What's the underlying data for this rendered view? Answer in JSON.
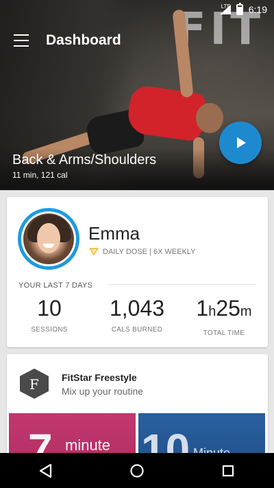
{
  "status_bar": {
    "network": "LTE",
    "time": "6:19"
  },
  "header": {
    "title": "Dashboard",
    "menu_icon": "hamburger-menu-icon",
    "watermark": "FIT"
  },
  "hero": {
    "workout_title": "Back & Arms/Shoulders",
    "workout_meta": "11 min, 121 cal",
    "play_icon": "play-icon",
    "accent_color": "#1f89d0"
  },
  "profile": {
    "name": "Emma",
    "daily_dose": "DAILY DOSE | 6X WEEKLY",
    "ring_color": "#1e9be0",
    "last_days_label": "YOUR LAST 7 DAYS",
    "stats": [
      {
        "value": "10",
        "label": "SESSIONS"
      },
      {
        "value": "1,043",
        "label": "CALS BURNED"
      },
      {
        "hours": "1",
        "h_unit": "h",
        "minutes": "25",
        "m_unit": "m",
        "label": "TOTAL TIME"
      }
    ]
  },
  "freestyle": {
    "logo_letter": "F",
    "title": "FitStar Freestyle",
    "subtitle": "Mix up your routine",
    "tiles": [
      {
        "big": "7",
        "small": "minute",
        "color": "#c2386e"
      },
      {
        "big": "10",
        "small": "Minute",
        "color": "#2a5f9e"
      }
    ]
  },
  "nav_bar": {
    "back_icon": "back-icon",
    "home_icon": "home-icon",
    "recents_icon": "recents-icon"
  }
}
